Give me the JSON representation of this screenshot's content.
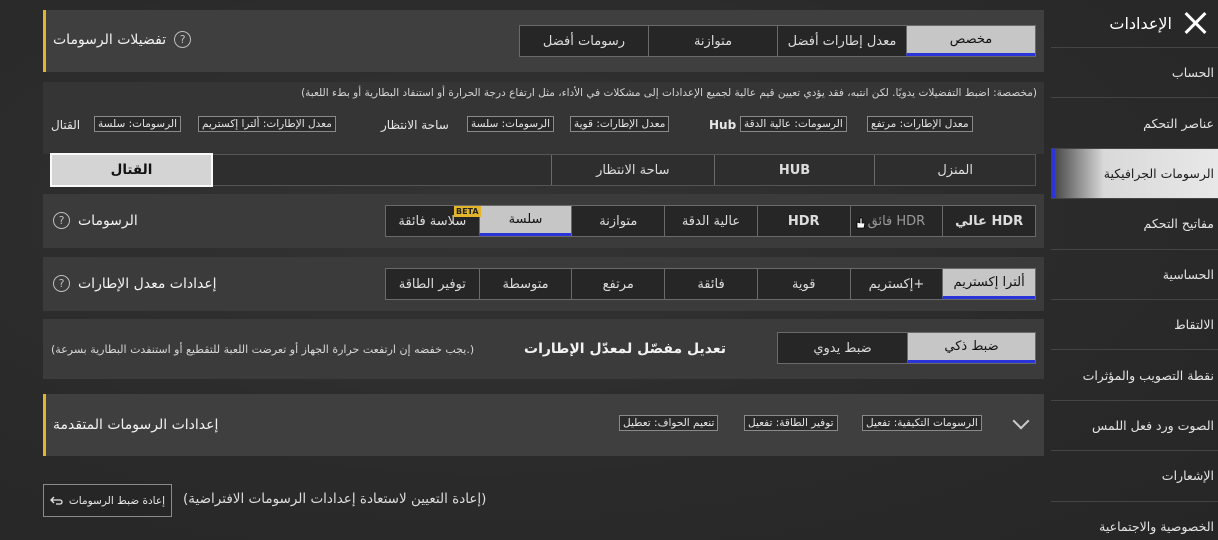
{
  "sidebar": {
    "title": "الإعدادات",
    "items": [
      {
        "label": "الحساب",
        "active": false
      },
      {
        "label": "عناصر التحكم",
        "active": false
      },
      {
        "label": "الرسومات الجرافيكية",
        "active": true
      },
      {
        "label": "مفاتيح التحكم",
        "active": false
      },
      {
        "label": "الحساسية",
        "active": false
      },
      {
        "label": "الالتقاط",
        "active": false
      },
      {
        "label": "نقطة التصويب والمؤثرات",
        "active": false
      },
      {
        "label": "الصوت ورد فعل اللمس",
        "active": false
      },
      {
        "label": "الإشعارات",
        "active": false
      },
      {
        "label": "الخصوصية والاجتماعية",
        "active": false
      }
    ]
  },
  "preferences": {
    "title": "تفضيلات الرسومات",
    "options": [
      "مخصص",
      "معدل إطارات أفضل",
      "متوازنة",
      "رسومات أفضل"
    ],
    "selected": 0,
    "note": "(مخصصة: اضبط التفضيلات يدويًا. لكن انتبه، فقد يؤدي تعيين قيم عالية لجميع الإعدادات إلى مشكلات في الأداء، مثل ارتفاع درجة الحرارة أو استنفاد البطارية أو بطء اللعبة)",
    "presets": {
      "hub_label": "Hub",
      "hub_fps": "معدل الإطارات: مرتفع",
      "hub_graphics": "الرسومات: عالية الدقة",
      "lobby_label": "ساحة الانتظار",
      "lobby_fps": "معدل الإطارات: قوية",
      "lobby_graphics": "الرسومات: سلسة",
      "combat_label": "القتال",
      "combat_fps": "معدل الإطارات: ألترا إكستريم",
      "combat_graphics": "الرسومات: سلسة"
    }
  },
  "scene_tabs": {
    "items": [
      "المنزل",
      "HUB",
      "ساحة الانتظار",
      "القتال"
    ],
    "selected": 3
  },
  "graphics": {
    "title": "الرسومات",
    "options": [
      "عالي HDR",
      "فائق HDR",
      "HDR",
      "عالية الدقة",
      "متوازنة",
      "سلسة",
      "سلاسة فائقة"
    ],
    "selected": 5,
    "beta_badge": "BETA"
  },
  "fps": {
    "title": "إعدادات معدل الإطارات",
    "options": [
      "ألترا إكستريم",
      "إكستريم+",
      "قوية",
      "فائقة",
      "مرتفع",
      "متوسطة",
      "توفير الطاقة"
    ],
    "selected": 0
  },
  "adaptive": {
    "title": "تعديل مفصّل لمعدّل الإطارات",
    "note": "(يجب خفضه إن ارتفعت حرارة الجهاز أو تعرضت اللعبة للتقطيع أو استنفدت البطارية بسرعة.)",
    "options": [
      "ضبط ذكي",
      "ضبط يدوي"
    ],
    "selected": 0
  },
  "advanced": {
    "title": "إعدادات الرسومات المتقدمة",
    "tags": [
      "الرسومات التكيفية: تفعيل",
      "توفير الطاقة: تفعيل",
      "تنعيم الحواف: تعطيل"
    ]
  },
  "reset": {
    "button_label": "إعادة ضبط الرسومات",
    "note": "(إعادة التعيين لاستعادة إعدادات الرسومات الافتراضية)"
  },
  "colors": {
    "accent_blue": "#2a34d8",
    "accent_gold": "#e2b52a",
    "selected_bg": "#c6c6c6"
  }
}
